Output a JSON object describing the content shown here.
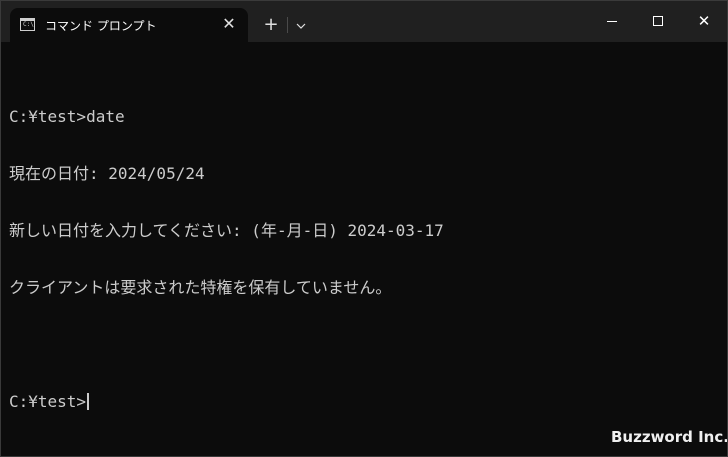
{
  "tab": {
    "icon": "terminal-icon",
    "icon_prompt": "C:\\",
    "title": "コマンド プロンプト",
    "close_glyph": "✕"
  },
  "toolbar": {
    "new_tab_glyph": "+",
    "dropdown_glyph": "⌄"
  },
  "window_controls": {
    "close_glyph": "✕"
  },
  "terminal": {
    "lines": [
      "C:¥test>date",
      "現在の日付: 2024/05/24",
      "新しい日付を入力してください: (年-月-日) 2024-03-17",
      "クライアントは要求された特権を保有していません。",
      "",
      "C:¥test>"
    ]
  },
  "watermark": "Buzzword Inc.",
  "colors": {
    "terminal_bg": "#0c0c0c",
    "titlebar_bg": "#202020",
    "text": "#cccccc"
  }
}
